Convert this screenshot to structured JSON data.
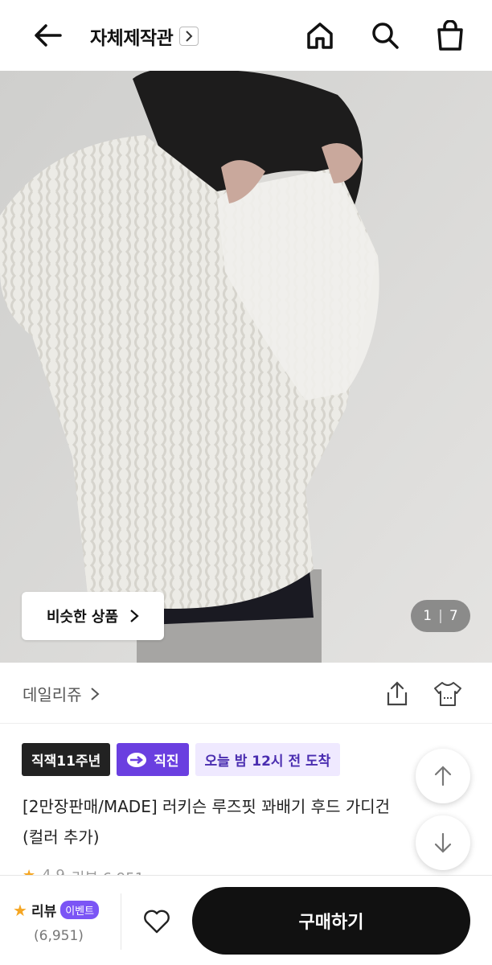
{
  "header": {
    "shop_title": "자체제작관",
    "icons": [
      "back-arrow-icon",
      "chevron-right-icon",
      "home-icon",
      "search-icon",
      "shopping-bag-icon"
    ]
  },
  "hero": {
    "similar_label": "비슷한 상품",
    "pager_current": "1",
    "pager_sep": "|",
    "pager_total": "7"
  },
  "brand": {
    "name": "데일리쥬",
    "icons": [
      "share-icon",
      "size-fit-icon"
    ]
  },
  "badges": {
    "years": "직잭11주년",
    "direct": "직진",
    "delivery": "오늘 밤 12시 전 도착"
  },
  "product": {
    "title_line1": "[2만장판매/MADE] 러키슨 루즈핏 꽈배기 후드 가디건",
    "title_line2": "(컬러 추가)",
    "rating_peek": "4.9",
    "review_peek": "리뷰 6,951"
  },
  "bottom": {
    "review_label": "리뷰",
    "event_label": "이벤트",
    "review_count": "(6,951)",
    "buy_label": "구매하기"
  },
  "colors": {
    "accent_purple": "#6a3fe0",
    "badge_light_bg": "#efe9ff",
    "star": "#f5a623",
    "buy_bg": "#111111"
  }
}
